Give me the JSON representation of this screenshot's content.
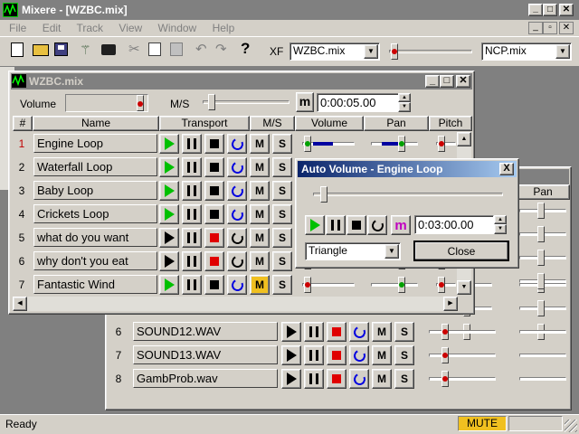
{
  "app": {
    "title": "Mixere - [WZBC.mix]"
  },
  "menu": [
    "File",
    "Edit",
    "Track",
    "View",
    "Window",
    "Help"
  ],
  "toolbar": {
    "xf_label": "XF",
    "mix_select": "WZBC.mix",
    "ncp_select": "NCP.mix"
  },
  "colors": {
    "title_active": "#0a246a",
    "face": "#d4d0c8",
    "green": "#00c000",
    "red": "#e00000",
    "blue": "#0000e0",
    "mute": "#f0c020"
  },
  "mixwin": {
    "title": "WZBC.mix",
    "volume_label": "Volume",
    "ms_label": "M/S",
    "m_button": "m",
    "time": "0:00:05.00",
    "headers": {
      "num": "#",
      "name": "Name",
      "transport": "Transport",
      "ms": "M/S",
      "volume": "Volume",
      "pan": "Pan",
      "pitch": "Pitch"
    },
    "tracks": [
      {
        "num": "1",
        "name": "Engine Loop"
      },
      {
        "num": "2",
        "name": "Waterfall Loop"
      },
      {
        "num": "3",
        "name": "Baby Loop"
      },
      {
        "num": "4",
        "name": "Crickets Loop"
      },
      {
        "num": "5",
        "name": "what do you want"
      },
      {
        "num": "6",
        "name": "why don't you eat"
      },
      {
        "num": "7",
        "name": "Fantastic Wind"
      }
    ],
    "m_label": "M",
    "s_label": "S"
  },
  "backwin": {
    "pan_header": "Pan",
    "tracks": [
      {
        "num": "6",
        "name": "SOUND12.WAV"
      },
      {
        "num": "7",
        "name": "SOUND13.WAV"
      },
      {
        "num": "8",
        "name": "GambProb.wav"
      }
    ]
  },
  "dialog": {
    "title": "Auto Volume - Engine Loop",
    "m_button": "m",
    "time": "0:03:00.00",
    "waveform": "Triangle",
    "close_label": "Close",
    "close_x": "X"
  },
  "status": {
    "text": "Ready",
    "mute": "MUTE"
  }
}
